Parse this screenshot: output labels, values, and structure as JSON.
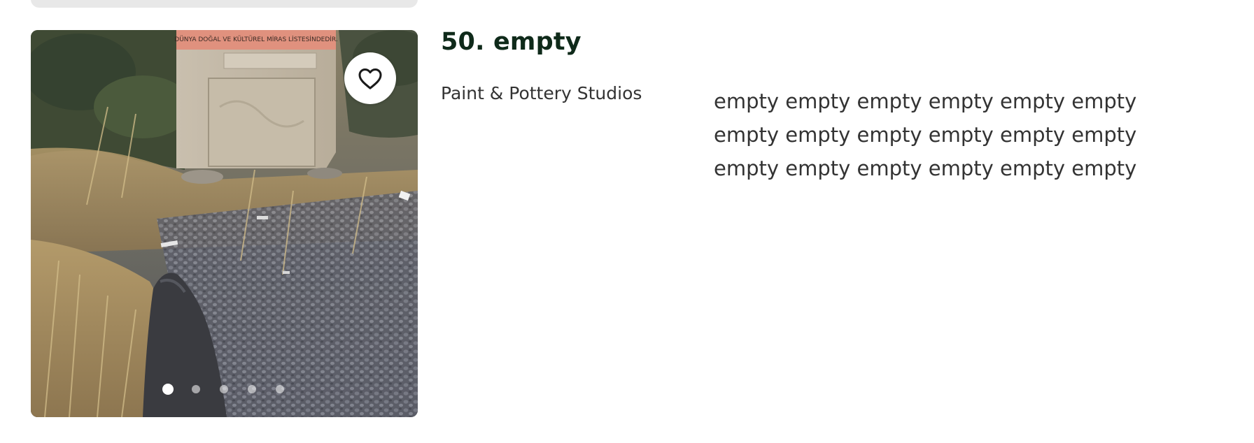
{
  "listing": {
    "title": "50. empty",
    "category": "Paint & Pottery Studios",
    "description": "empty empty empty empty empty empty empty empty empty empty empty empty empty empty empty empty empty empty",
    "photo_sign_text": "DÜNYA DOĞAL VE KÜLTÜREL MİRAS LİSTESİNDEDİR.",
    "save_action": "heart-icon",
    "carousel": {
      "count": 5,
      "active_index": 0
    }
  },
  "colors": {
    "title": "#0f2a1a",
    "body_text": "#333333",
    "sign_top": "#e0917e",
    "dot_active": "#ffffff"
  }
}
